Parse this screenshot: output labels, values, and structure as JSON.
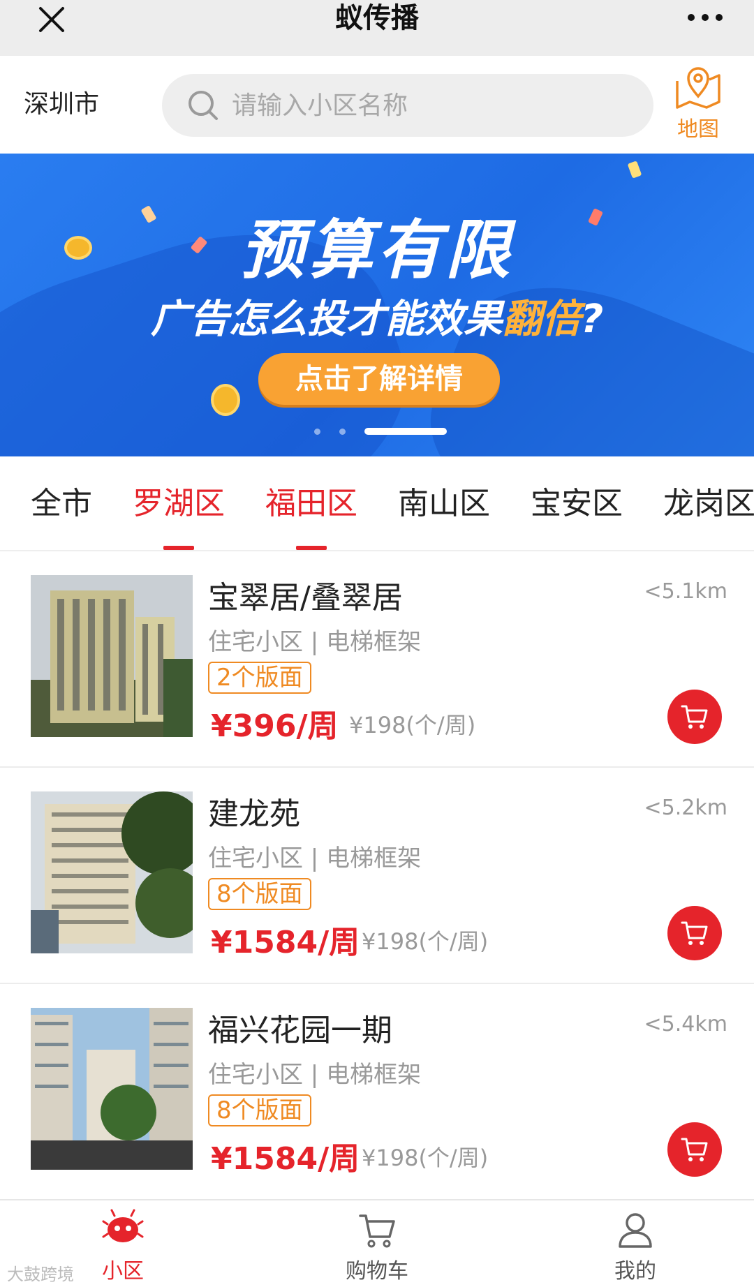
{
  "titlebar": {
    "title": "蚁传播",
    "close_icon": "close-icon",
    "more_icon": "more-icon"
  },
  "search": {
    "city": "深圳市",
    "placeholder": "请输入小区名称",
    "map_label": "地图"
  },
  "banner": {
    "headline": "预算有限",
    "subline_prefix": "广告怎么投才能效果",
    "subline_highlight": "翻倍",
    "subline_suffix": "?",
    "cta": "点击了解详情",
    "active_slide": 3,
    "slide_count": 3
  },
  "tabs": [
    {
      "label": "全市",
      "active": false
    },
    {
      "label": "罗湖区",
      "active": true
    },
    {
      "label": "福田区",
      "active": true
    },
    {
      "label": "南山区",
      "active": false
    },
    {
      "label": "宝安区",
      "active": false
    },
    {
      "label": "龙岗区",
      "active": false
    }
  ],
  "listings": [
    {
      "name": "宝翠居/叠翠居",
      "distance": "<5.1km",
      "meta": "住宅小区 | 电梯框架",
      "slots": "2个版面",
      "price": "¥396/周",
      "unit_price": "¥198(个/周)"
    },
    {
      "name": "建龙苑",
      "distance": "<5.2km",
      "meta": "住宅小区 | 电梯框架",
      "slots": "8个版面",
      "price": "¥1584/周",
      "unit_price": "¥198(个/周)"
    },
    {
      "name": "福兴花园一期",
      "distance": "<5.4km",
      "meta": "住宅小区 | 电梯框架",
      "slots": "8个版面",
      "price": "¥1584/周",
      "unit_price": "¥198(个/周)"
    }
  ],
  "bottom_nav": [
    {
      "label": "小区",
      "icon": "ant-icon",
      "active": true
    },
    {
      "label": "购物车",
      "icon": "cart-icon",
      "active": false
    },
    {
      "label": "我的",
      "icon": "user-icon",
      "active": false
    }
  ],
  "watermark": "大鼓跨境",
  "colors": {
    "accent_red": "#e5242b",
    "accent_orange": "#ef8a22",
    "banner_blue": "#1e6be4"
  }
}
